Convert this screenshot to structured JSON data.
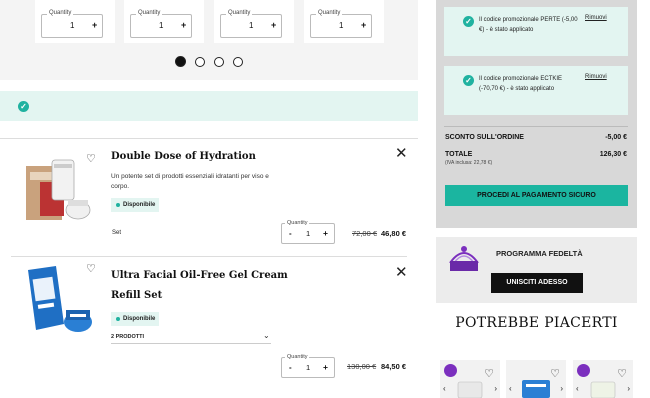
{
  "top_carousel": {
    "cards": [
      {
        "quantity_label": "Quantity",
        "quantity": "1"
      },
      {
        "quantity_label": "Quantity",
        "quantity": "1"
      },
      {
        "quantity_label": "Quantity",
        "quantity": "1"
      },
      {
        "quantity_label": "Quantity",
        "quantity": "1"
      }
    ],
    "page_count": 4,
    "active_page": 1
  },
  "cart": {
    "items": [
      {
        "title": "Double Dose of Hydration",
        "description": "Un potente set di prodotti essenziali idratanti per viso e corpo.",
        "availability": "Disponibile",
        "type": "Set",
        "quantity_label": "Quantity",
        "quantity": "1",
        "old_price": "72,00 €",
        "price": "46,80 €"
      },
      {
        "title_line1": "Ultra Facial Oil-Free Gel Cream",
        "title_line2": "Refill Set",
        "availability": "Disponibile",
        "variant": "2 PRODOTTI",
        "quantity_label": "Quantity",
        "quantity": "1",
        "old_price": "130,00 €",
        "price": "84,50 €"
      }
    ],
    "qty_minus": "-",
    "qty_plus": "+"
  },
  "summary": {
    "promos": [
      {
        "text": "Il codice promozionale PERTE (-5,00 €) - è stato applicato",
        "remove_label": "Rimuovi"
      },
      {
        "text": "Il codice promozionale ECTKIE (-70,70 €) - è stato applicato",
        "remove_label": "Rimuovi"
      }
    ],
    "order_discount_label": "SCONTO SULL'ORDINE",
    "order_discount_value": "-5,00 €",
    "total_label": "TOTALE",
    "total_value": "126,30 €",
    "vat_note": "(IVA inclusa: 22,78 €)",
    "checkout_button": "PROCEDI AL PAGAMENTO SICURO"
  },
  "loyalty": {
    "title": "PROGRAMMA FEDELTÀ",
    "button": "UNISCITI ADESSO"
  },
  "recommendations": {
    "title": "POTREBBE PIACERTI"
  },
  "colors": {
    "accent": "#1bb5a0",
    "mint": "#e3f5f1",
    "panel": "#d8d8d8",
    "badge_purple": "#7b2fbe"
  }
}
